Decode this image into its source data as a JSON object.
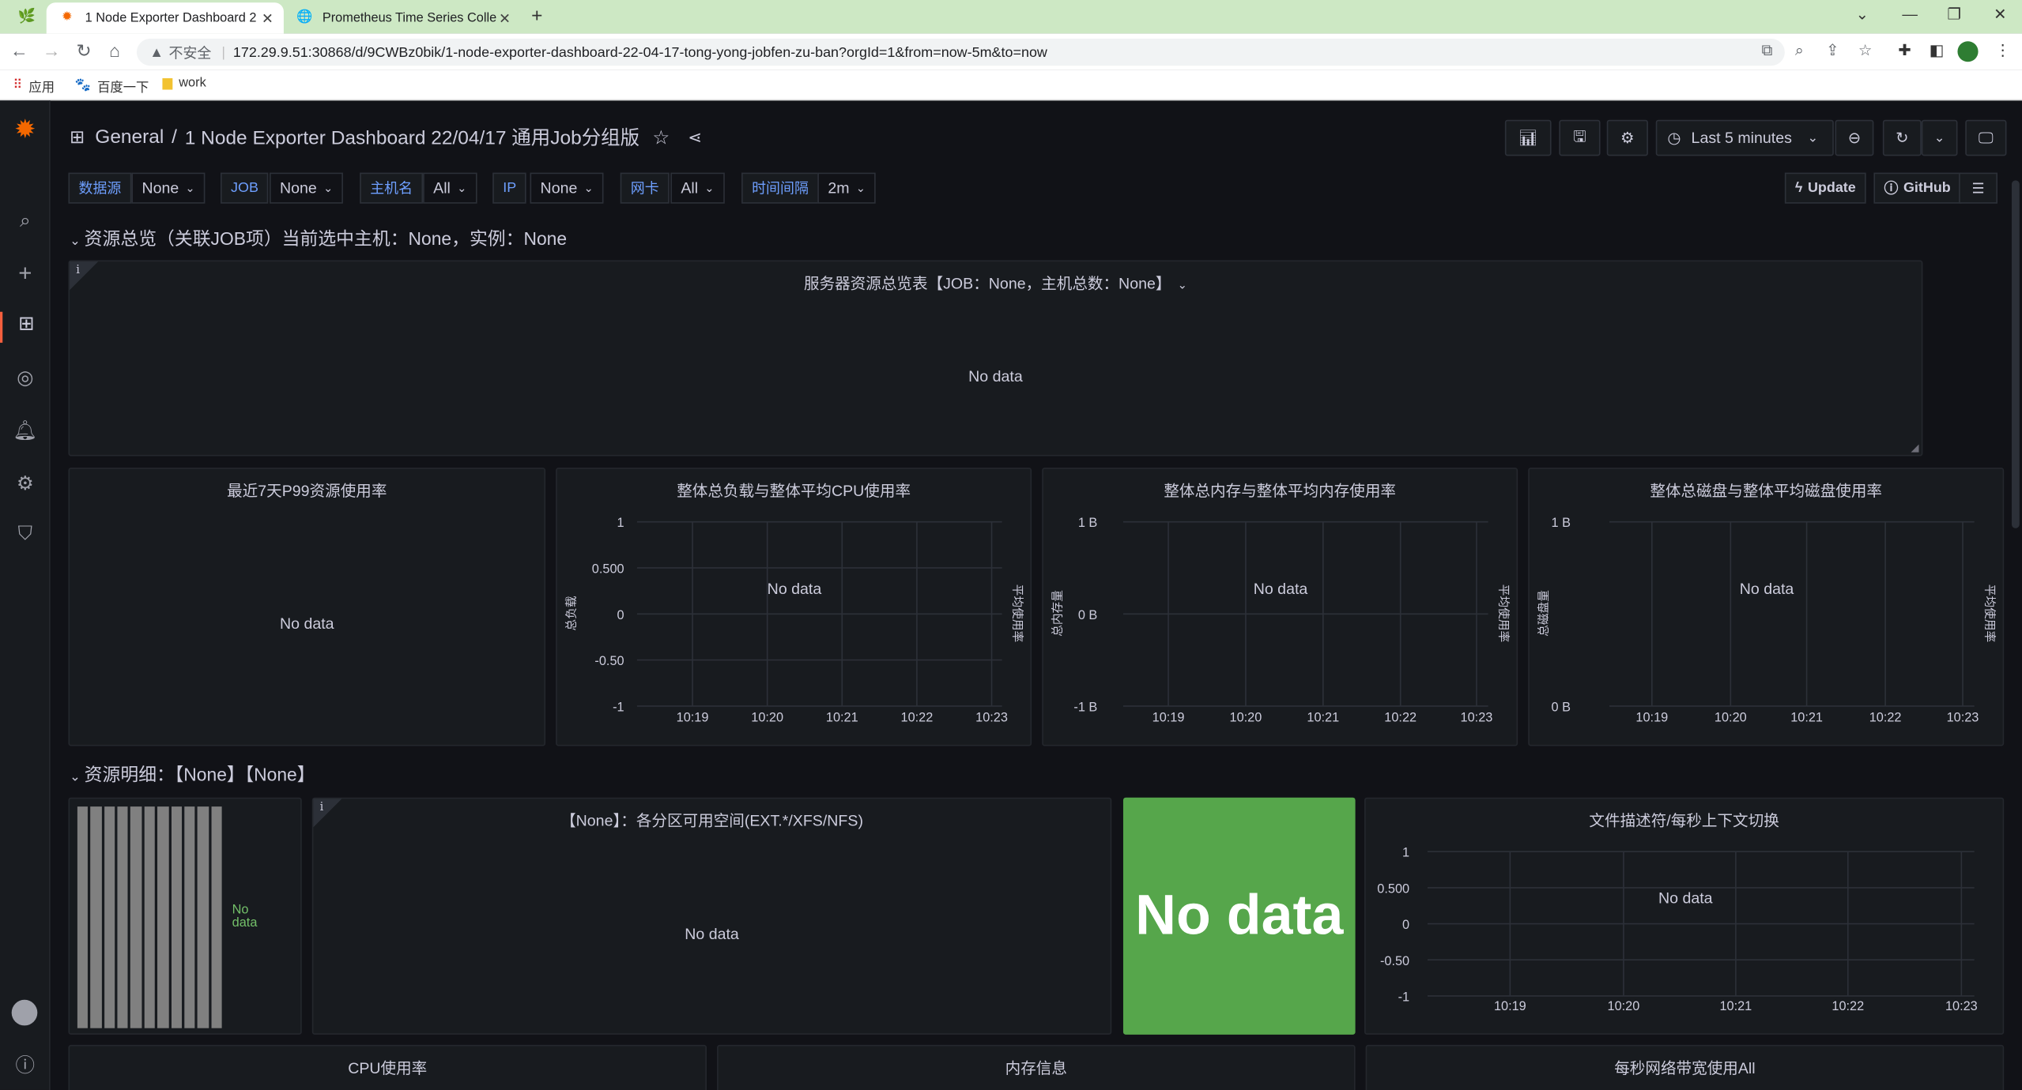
{
  "browser": {
    "tabs": [
      {
        "title": "1 Node Exporter Dashboard 2",
        "icon": "grafana-icon"
      },
      {
        "title": "Prometheus Time Series Colle",
        "icon": "globe-icon"
      }
    ],
    "insecure_label": "不安全",
    "url": "172.29.9.51:30868/d/9CWBz0bik/1-node-exporter-dashboard-22-04-17-tong-yong-jobfen-zu-ban?orgId=1&from=now-5m&to=now",
    "bookmarks": [
      "应用",
      "百度一下",
      "work"
    ]
  },
  "dashboard": {
    "folder": "General",
    "separator": "/",
    "title": "1 Node Exporter Dashboard 22/04/17 通用Job分组版",
    "time_range": "Last 5 minutes"
  },
  "variables": [
    {
      "label": "数据源",
      "value": "None"
    },
    {
      "label": "JOB",
      "value": "None"
    },
    {
      "label": "主机名",
      "value": "All"
    },
    {
      "label": "IP",
      "value": "None"
    },
    {
      "label": "网卡",
      "value": "All"
    },
    {
      "label": "时间间隔",
      "value": "2m"
    }
  ],
  "links": {
    "update": "Update",
    "github": "GitHub"
  },
  "rows": {
    "overview": "资源总览（关联JOB项）当前选中主机：None，实例：None",
    "detail": "资源明细：【None】【None】"
  },
  "panels": {
    "server_table": {
      "title": "服务器资源总览表【JOB：None，主机总数：None】",
      "nodata": "No data"
    },
    "p99": {
      "title": "最近7天P99资源使用率",
      "nodata": "No data"
    },
    "cpu_load": {
      "title": "整体总负载与整体平均CPU使用率",
      "nodata": "No data",
      "left_axis": "总负载",
      "right_axis": "平均使用率"
    },
    "memory": {
      "title": "整体总内存与整体平均内存使用率",
      "nodata": "No data",
      "left_axis": "总内存量",
      "right_axis": "平均使用率"
    },
    "disk": {
      "title": "整体总磁盘与整体平均磁盘使用率",
      "nodata": "No data",
      "left_axis": "总磁盘量",
      "right_axis": "平均使用率"
    },
    "gauge_bars": {
      "nodata": "No data"
    },
    "partitions": {
      "title": "【None】：各分区可用空间(EXT.*/XFS/NFS)",
      "nodata": "No data"
    },
    "stat": {
      "nodata": "No data",
      "color": "#56a64b"
    },
    "fd_ctx": {
      "title": "文件描述符/每秒上下文切换",
      "nodata": "No data"
    },
    "cpu_usage": {
      "title": "CPU使用率"
    },
    "mem_info": {
      "title": "内存信息"
    },
    "net_bw": {
      "title": "每秒网络带宽使用All"
    }
  },
  "chart_data": [
    {
      "type": "line",
      "title": "整体总负载与整体平均CPU使用率",
      "x": [
        "10:19",
        "10:20",
        "10:21",
        "10:22",
        "10:23"
      ],
      "yticks": [
        "1",
        "0.500",
        "0",
        "-0.50",
        "-1"
      ],
      "ylim": [
        -1,
        1
      ],
      "ylabel": "总负载",
      "y2label": "平均使用率",
      "series": [],
      "grid": true
    },
    {
      "type": "line",
      "title": "整体总内存与整体平均内存使用率",
      "x": [
        "10:19",
        "10:20",
        "10:21",
        "10:22",
        "10:23"
      ],
      "yticks": [
        "1 B",
        "0 B",
        "-1 B"
      ],
      "ylabel": "总内存量",
      "y2label": "平均使用率",
      "series": [],
      "grid": true
    },
    {
      "type": "line",
      "title": "整体总磁盘与整体平均磁盘使用率",
      "x": [
        "10:19",
        "10:20",
        "10:21",
        "10:22",
        "10:23"
      ],
      "yticks": [
        "1 B",
        "0 B"
      ],
      "ylabel": "总磁盘量",
      "y2label": "平均使用率",
      "series": [],
      "grid": true
    },
    {
      "type": "line",
      "title": "文件描述符/每秒上下文切换",
      "x": [
        "10:19",
        "10:20",
        "10:21",
        "10:22",
        "10:23"
      ],
      "yticks": [
        "1",
        "0.500",
        "0",
        "-0.50",
        "-1"
      ],
      "ylim": [
        -1,
        1
      ],
      "series": [],
      "grid": true
    }
  ]
}
